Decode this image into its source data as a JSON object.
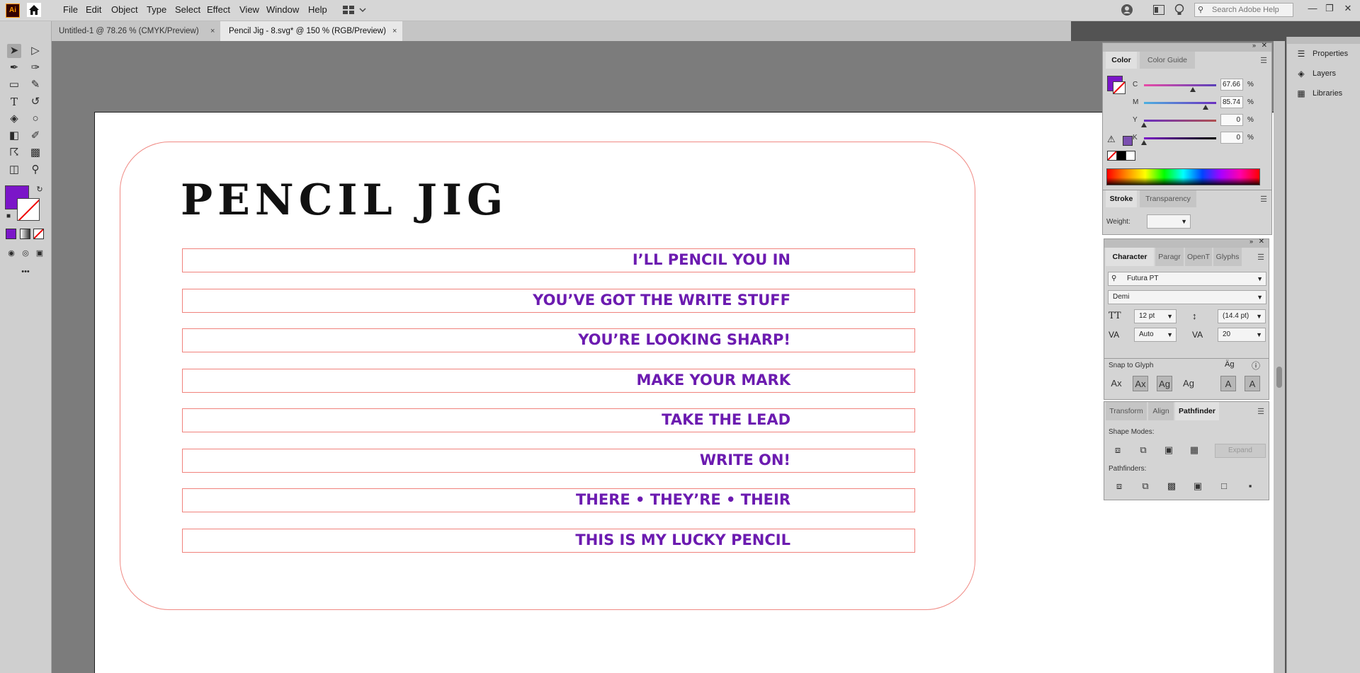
{
  "app": {
    "logo_text": "Ai"
  },
  "menu": [
    "File",
    "Edit",
    "Object",
    "Type",
    "Select",
    "Effect",
    "View",
    "Window",
    "Help"
  ],
  "search": {
    "placeholder": "Search Adobe Help"
  },
  "tabs": [
    {
      "label": "Untitled-1 @ 78.26 % (CMYK/Preview)",
      "close": "×"
    },
    {
      "label": "Pencil Jig - 8.svg* @ 150 % (RGB/Preview)",
      "close": "×"
    }
  ],
  "toolbar": {
    "more": "•••"
  },
  "artwork": {
    "title": "PENCIL JIG",
    "strips": [
      "I’LL PENCIL YOU IN",
      "YOU’VE GOT THE WRITE STUFF",
      "YOU’RE LOOKING SHARP!",
      "MAKE YOUR MARK",
      "TAKE THE LEAD",
      "WRITE ON!",
      "THERE  •  THEY’RE  •  THEIR",
      "THIS IS MY LUCKY PENCIL"
    ],
    "text_color": "#6c1bb0",
    "stroke_color": "#f0827c"
  },
  "dock": [
    {
      "label": "Properties",
      "icon": "properties-icon"
    },
    {
      "label": "Layers",
      "icon": "layers-icon"
    },
    {
      "label": "Libraries",
      "icon": "libraries-icon"
    }
  ],
  "color_panel": {
    "tabs": [
      "Color",
      "Color Guide"
    ],
    "channels": [
      {
        "label": "C",
        "value": "67.66",
        "pos": 0.6766
      },
      {
        "label": "M",
        "value": "85.74",
        "pos": 0.8574
      },
      {
        "label": "Y",
        "value": "0",
        "pos": 0
      },
      {
        "label": "K",
        "value": "0",
        "pos": 0
      }
    ],
    "percent": "%",
    "fill_color": "#7b16c8"
  },
  "stroke_panel": {
    "tabs": [
      "Stroke",
      "Transparency"
    ],
    "weight_label": "Weight:"
  },
  "character_panel": {
    "tabs": [
      "Character",
      "Paragr",
      "OpenT",
      "Glyphs"
    ],
    "font_family": "Futura PT",
    "font_style": "Demi",
    "font_size": "12 pt",
    "leading": "(14.4 pt)",
    "kerning": "Auto",
    "tracking": "20",
    "snap_label": "Snap to Glyph"
  },
  "pathfinder_panel": {
    "tabs": [
      "Transform",
      "Align",
      "Pathfinder"
    ],
    "shape_modes_label": "Shape Modes:",
    "expand_label": "Expand",
    "pathfinders_label": "Pathfinders:"
  }
}
